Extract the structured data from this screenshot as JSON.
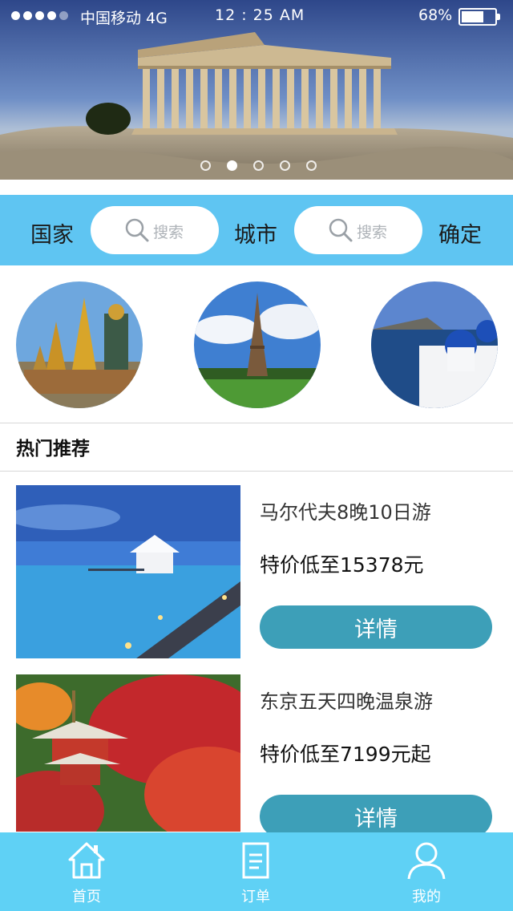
{
  "status_bar": {
    "carrier": "中国移动 4G",
    "time": "12 : 25 AM",
    "battery_percent": "68%",
    "battery_level": 0.68,
    "signal_bars": 4
  },
  "banner": {
    "subject": "parthenon",
    "slide_count": 5,
    "active_slide": 1
  },
  "search": {
    "country_label": "国家",
    "country_placeholder": "搜索",
    "city_label": "城市",
    "city_placeholder": "搜索",
    "confirm_label": "确定"
  },
  "destinations": [
    {
      "icon": "thailand-temple-image"
    },
    {
      "icon": "eiffel-tower-image"
    },
    {
      "icon": "santorini-image"
    }
  ],
  "section_title": "热门推荐",
  "deals": [
    {
      "name": "马尔代夫8晚10日游",
      "price": "特价低至15378元",
      "button": "详情",
      "image": "maldives-pier-image"
    },
    {
      "name": "东京五天四晚温泉游",
      "price": "特价低至7199元起",
      "button": "详情",
      "image": "japan-pagoda-image"
    }
  ],
  "tabbar": {
    "tabs": [
      {
        "label": "首页",
        "icon": "home-icon"
      },
      {
        "label": "订单",
        "icon": "order-document-icon"
      },
      {
        "label": "我的",
        "icon": "profile-icon"
      }
    ]
  },
  "colors": {
    "accent_blue": "#5fc5f2",
    "button_teal": "#3d9fb8",
    "tabbar": "#5fd1f5"
  }
}
